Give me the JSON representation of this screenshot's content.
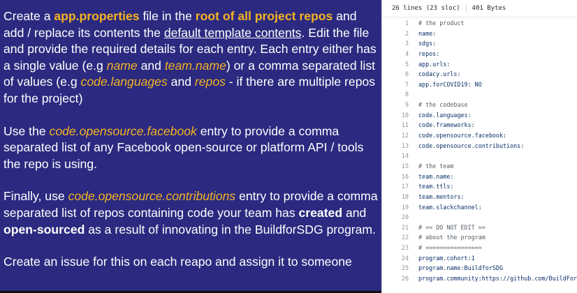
{
  "slide": {
    "p1": {
      "t1": "Create a ",
      "h1": "app.properties",
      "t2": " file in the ",
      "h2": "root of all project repos",
      "t3": " and add / replace its contents the ",
      "u1": "default template contents",
      "t4": ". Edit the file and provide the required details for each entry. Each entry either has a single value (e.g ",
      "i1": "name",
      "t5": " and ",
      "i2": "team.name",
      "t6": ") or a comma separated list of values (e.g ",
      "i3": "code.languages",
      "t7": " and ",
      "i4": "repos",
      "t8": " - if there are multiple repos for the project)"
    },
    "p2": {
      "t1": "Use the ",
      "i1": "code.opensource.facebook",
      "t2": " entry to provide a comma separated list of any Facebook open-source or platform API / tools the repo is using."
    },
    "p3": {
      "t1": "Finally, use ",
      "i1": "code.opensource.contributions",
      "t2": " entry to provide a comma separated list of repos containing code your team has ",
      "b1": "created",
      "t3": " and ",
      "b2": "open-sourced",
      "t4": " as a result of innovating in the BuildforSDG program."
    },
    "p4": {
      "t1": "Create an issue for this on each reapo and assign it to someone"
    }
  },
  "file": {
    "lines_info": "26 lines (23 sloc)",
    "size": "401 Bytes",
    "lines": [
      {
        "n": "1",
        "text": "# the product",
        "comment": true
      },
      {
        "n": "2",
        "text": "name:"
      },
      {
        "n": "3",
        "text": "sdgs:"
      },
      {
        "n": "4",
        "text": "repos:"
      },
      {
        "n": "5",
        "text": "app.urls:"
      },
      {
        "n": "6",
        "text": "codacy.urls:"
      },
      {
        "n": "7",
        "text": "app.forCOVID19: NO"
      },
      {
        "n": "8",
        "text": ""
      },
      {
        "n": "9",
        "text": "# the codebase",
        "comment": true
      },
      {
        "n": "10",
        "text": "code.languages:"
      },
      {
        "n": "11",
        "text": "code.frameworks:"
      },
      {
        "n": "12",
        "text": "code.opensource.facebook:"
      },
      {
        "n": "13",
        "text": "code.opensource.contributions:"
      },
      {
        "n": "14",
        "text": ""
      },
      {
        "n": "15",
        "text": "# the team",
        "comment": true
      },
      {
        "n": "16",
        "text": "team.name:"
      },
      {
        "n": "17",
        "text": "team.ttls:"
      },
      {
        "n": "18",
        "text": "team.mentors:"
      },
      {
        "n": "19",
        "text": "team.slackchannel:"
      },
      {
        "n": "20",
        "text": ""
      },
      {
        "n": "21",
        "text": "# == DO NOT EDIT ==",
        "comment": true
      },
      {
        "n": "22",
        "text": "# about the program",
        "comment": true
      },
      {
        "n": "23",
        "text": "# ================",
        "comment": true
      },
      {
        "n": "24",
        "text": "program.cohort:1"
      },
      {
        "n": "25",
        "text": "program.name:BuildforSDG"
      },
      {
        "n": "26",
        "text": "program.community:https://github.com/BuildForSDG"
      }
    ]
  },
  "colors": {
    "slide_bg": "#2b2a80",
    "highlight": "#f5b322",
    "code_text": "#0a3069",
    "comment": "#57606a",
    "line_number": "#8c959f"
  }
}
